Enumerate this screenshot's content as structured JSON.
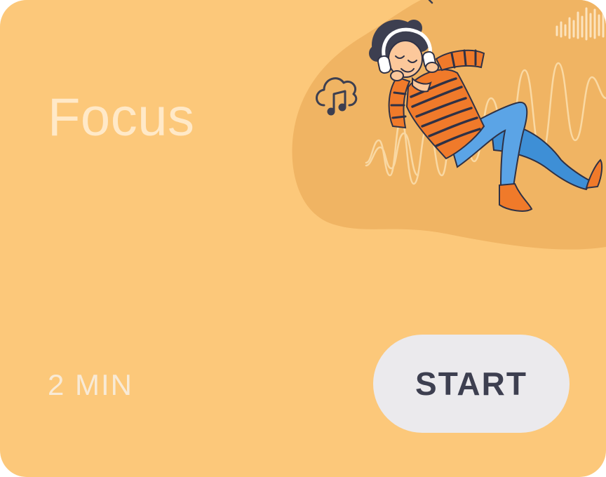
{
  "card": {
    "title": "Focus",
    "duration": "2 MIN",
    "start_label": "START",
    "colors": {
      "background": "#FCC87A",
      "blob": "#F0B463",
      "button_bg": "#EBEAED",
      "button_text": "#3D3F50"
    }
  },
  "illustration": {
    "subject": "person-lying-with-headphones",
    "icons": [
      "music-cloud-icon",
      "sound-wave-icon"
    ]
  }
}
